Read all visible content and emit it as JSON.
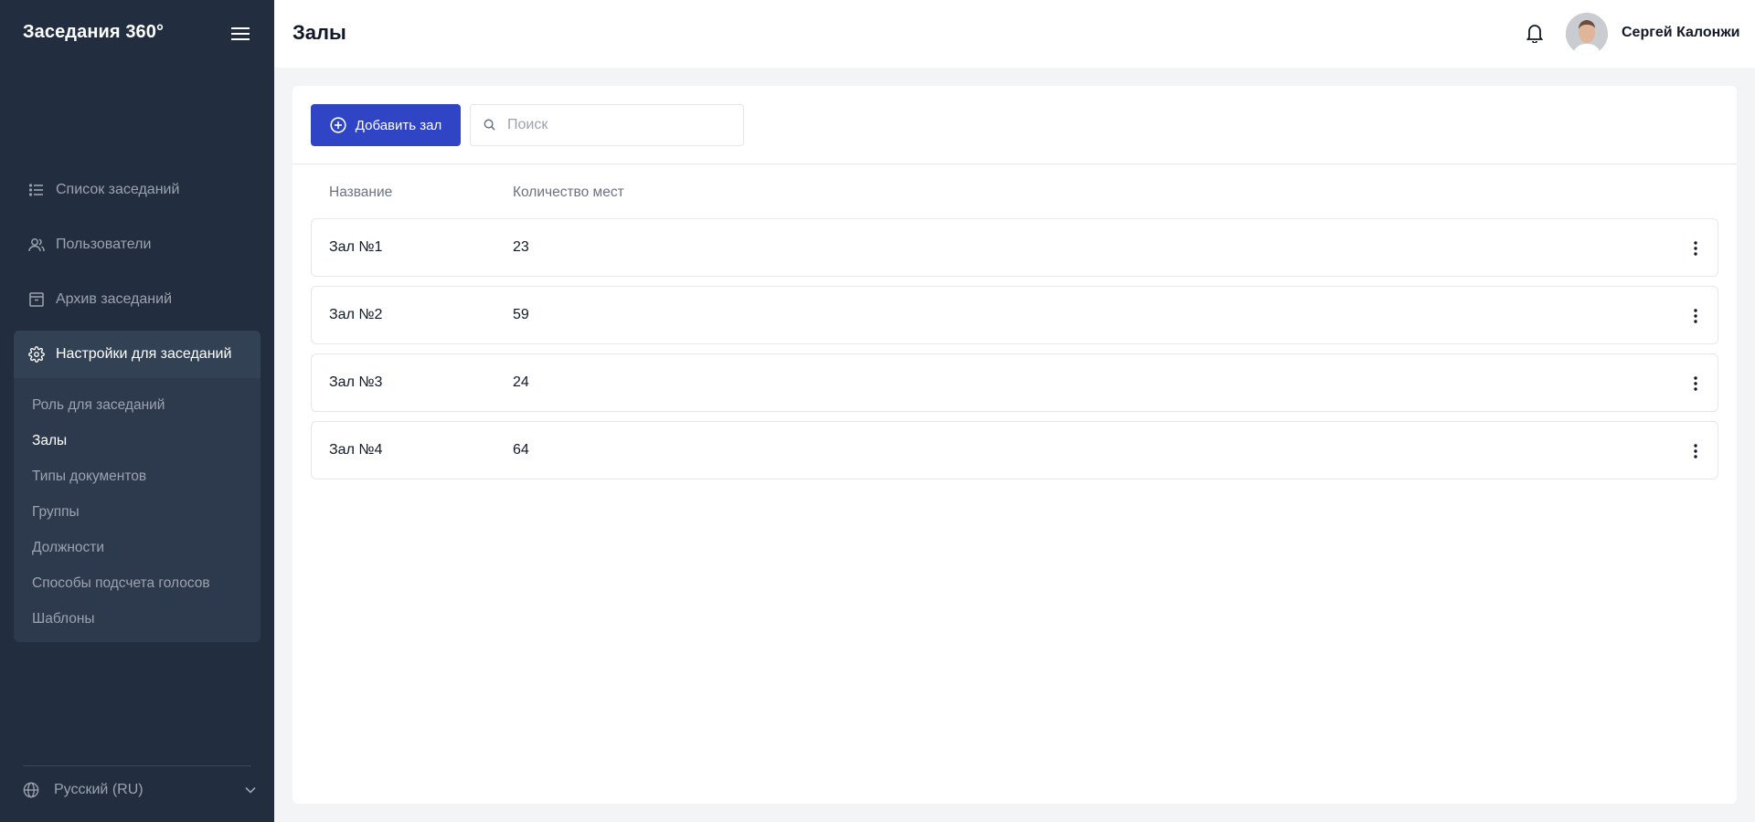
{
  "app": {
    "title": "Заседания 360°"
  },
  "sidebar": {
    "items": [
      {
        "label": "Список заседаний",
        "icon": "list-icon"
      },
      {
        "label": "Пользователи",
        "icon": "users-icon"
      },
      {
        "label": "Архив заседаний",
        "icon": "archive-icon"
      }
    ],
    "settings": {
      "label": "Настройки для заседаний",
      "icon": "gear-icon",
      "sub_items": [
        {
          "label": "Роль для заседаний",
          "active": false
        },
        {
          "label": "Залы",
          "active": true
        },
        {
          "label": "Типы документов",
          "active": false
        },
        {
          "label": "Группы",
          "active": false
        },
        {
          "label": "Должности",
          "active": false
        },
        {
          "label": "Способы подсчета голосов",
          "active": false
        },
        {
          "label": "Шаблоны",
          "active": false
        }
      ]
    },
    "language": {
      "label": "Русский (RU)",
      "icon": "globe-icon"
    }
  },
  "header": {
    "title": "Залы",
    "user_name": "Сергей Калонжи"
  },
  "toolbar": {
    "add_label": "Добавить зал",
    "search_placeholder": "Поиск",
    "search_value": ""
  },
  "table": {
    "columns": [
      "Название",
      "Количество мест"
    ],
    "rows": [
      {
        "name": "Зал №1",
        "seats": "23"
      },
      {
        "name": "Зал №2",
        "seats": "59"
      },
      {
        "name": "Зал №3",
        "seats": "24"
      },
      {
        "name": "Зал №4",
        "seats": "64"
      }
    ]
  },
  "colors": {
    "sidebar_bg": "#222e3f",
    "accent": "#2f45c5",
    "page_bg": "#f3f4f6"
  }
}
